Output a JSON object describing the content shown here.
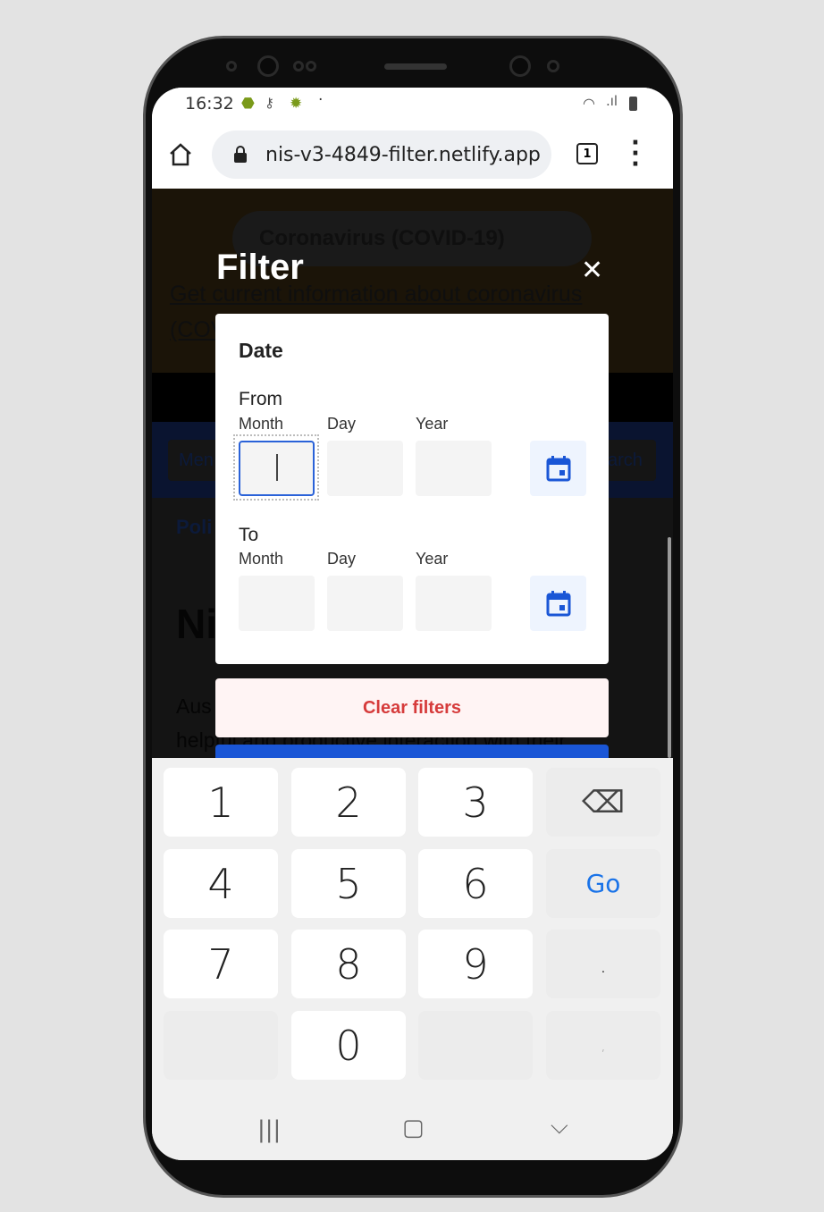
{
  "status_bar": {
    "time": "16:32",
    "icons": [
      "android-icon",
      "key-icon",
      "android-debug-icon",
      "dot-icon",
      "wifi-icon",
      "signal-icon",
      "battery-icon"
    ]
  },
  "browser": {
    "url": "nis-v3-4849-filter.netlify.app",
    "tab_count": "1",
    "icons": [
      "home-icon",
      "lock-icon",
      "tabs-icon",
      "more-vert-icon"
    ]
  },
  "background_page": {
    "banner": "Coronavirus (COVID-19)",
    "link_line1": "Get current information about coronavirus",
    "link_line2": "(COV",
    "menu_button": "Men",
    "search_button": "arch",
    "nav_item": "Poli",
    "heading": "Ni",
    "para_line1": "Aus",
    "para_line2": "helpful and productive interaction with their"
  },
  "filter": {
    "title": "Filter",
    "close": "✕",
    "section": "Date",
    "from": {
      "label": "From",
      "month": "Month",
      "day": "Day",
      "year": "Year",
      "month_value": "",
      "day_value": "",
      "year_value": ""
    },
    "to": {
      "label": "To",
      "month": "Month",
      "day": "Day",
      "year": "Year",
      "month_value": "",
      "day_value": "",
      "year_value": ""
    },
    "clear_label": "Clear filters",
    "colors": {
      "accent": "#1a56d6",
      "danger": "#d63b3b"
    }
  },
  "keyboard": {
    "keys": [
      "1",
      "2",
      "3",
      "⌫",
      "4",
      "5",
      "6",
      "Go",
      "7",
      "8",
      "9",
      ".",
      "",
      "0",
      "",
      ","
    ]
  },
  "navbar": {
    "recents": "|||",
    "home": "▢",
    "back": "⌵"
  }
}
